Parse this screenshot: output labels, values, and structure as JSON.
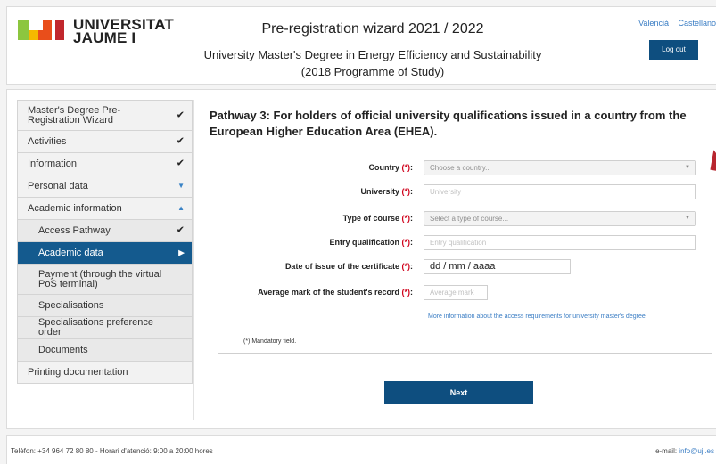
{
  "header": {
    "logo_line1": "UNIVERSITAT",
    "logo_line2": "JAUME I",
    "title": "Pre-registration wizard 2021 / 2022",
    "subtitle_line1": "University Master's Degree in Energy Efficiency and Sustainability",
    "subtitle_line2": "(2018 Programme of Study)",
    "lang_valencia": "Valencià",
    "lang_castellano": "Castellano",
    "logout_label": "Log out",
    "logo_colors": {
      "green": "#8cc63f",
      "yellow": "#f5b800",
      "orange": "#e94e1b",
      "red": "#c1272d"
    }
  },
  "sidebar": {
    "items": [
      {
        "label": "Master's Degree Pre-Registration Wizard",
        "marker": "check",
        "sub": false,
        "active": false
      },
      {
        "label": "Activities",
        "marker": "check",
        "sub": false,
        "active": false
      },
      {
        "label": "Information",
        "marker": "check",
        "sub": false,
        "active": false
      },
      {
        "label": "Personal data",
        "marker": "caret-down",
        "sub": false,
        "active": false
      },
      {
        "label": "Academic information",
        "marker": "caret-up",
        "sub": false,
        "active": false
      },
      {
        "label": "Access Pathway",
        "marker": "check",
        "sub": true,
        "active": false
      },
      {
        "label": "Academic data",
        "marker": "caret-right",
        "sub": true,
        "active": true
      },
      {
        "label": "Payment (through the virtual PoS terminal)",
        "marker": "",
        "sub": true,
        "active": false
      },
      {
        "label": "Specialisations",
        "marker": "",
        "sub": true,
        "active": false
      },
      {
        "label": "Specialisations preference order",
        "marker": "",
        "sub": true,
        "active": false
      },
      {
        "label": "Documents",
        "marker": "",
        "sub": true,
        "active": false
      },
      {
        "label": "Printing documentation",
        "marker": "",
        "sub": false,
        "active": false
      }
    ]
  },
  "content": {
    "heading": "Pathway 3: For holders of official university qualifications issued in a country from the European Higher Education Area (EHEA).",
    "req_marker": "(*)",
    "fields": {
      "country": {
        "label": "Country",
        "placeholder": "Choose a country..."
      },
      "university": {
        "label": "University",
        "placeholder": "University"
      },
      "course_type": {
        "label": "Type of course",
        "placeholder": "Select a type of course..."
      },
      "entry_qualification": {
        "label": "Entry qualification",
        "placeholder": "Entry qualification"
      },
      "issue_date": {
        "label": "Date of issue of the certificate",
        "value": "dd / mm / aaaa"
      },
      "average_mark": {
        "label": "Average mark of the student's record",
        "placeholder": "Average mark"
      }
    },
    "more_info": "More information about the access requirements for university master's degree",
    "mandatory_note": "(*)   Mandatory field.",
    "next_label": "Next"
  },
  "footer": {
    "phone": "Telèfon: +34 964 72 80 80 - Horari d'atenció: 9:00 a 20:00 hores",
    "email_label": "e-mail: ",
    "email": "info@uji.es"
  }
}
